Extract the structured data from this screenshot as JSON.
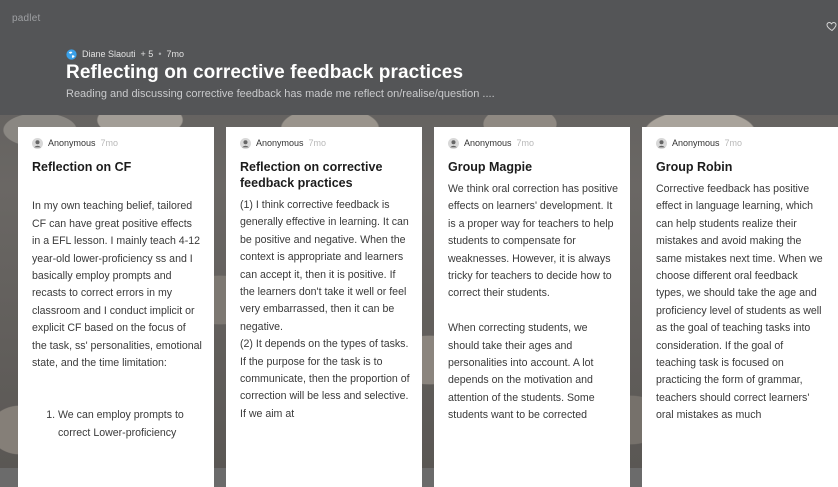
{
  "header": {
    "brand": "padlet",
    "author": "Diane Slaouti",
    "collaborators": "+ 5",
    "separator": "•",
    "time": "7mo",
    "title": "Reflecting on corrective feedback practices",
    "description": "Reading and discussing corrective feedback has made me reflect on/realise/question ....",
    "icons": {
      "favorite": "heart-icon",
      "author_avatar": "globe-icon"
    }
  },
  "posts": [
    {
      "author": "Anonymous",
      "time": "7mo",
      "title": "Reflection on CF",
      "body": "In my own teaching belief, tailored CF can have great positive effects in a EFL lesson. I mainly teach 4-12 year-old lower-proficiency ss and I basically employ prompts and recasts to correct errors in my classroom and I conduct implicit or explicit CF based on the focus of the task, ss' personalities, emotional state, and the time limitation:",
      "list": [
        "We can employ prompts to correct Lower-proficiency"
      ]
    },
    {
      "author": "Anonymous",
      "time": "7mo",
      "title": "Reflection on corrective feedback practices",
      "body": "(1) I think corrective feedback is generally effective in learning. It can be positive and negative. When the context is appropriate and learners can accept it, then it is positive. If the learners don't take it well or feel very embarrassed, then it can be negative.\n(2) It depends on the types of tasks. If the purpose for the task is to communicate, then the proportion of correction will be less and selective. If we aim at"
    },
    {
      "author": "Anonymous",
      "time": "7mo",
      "title": "Group Magpie",
      "body": "We think oral correction has positive effects on learners' development.  It is a proper way for teachers to help students to compensate for weaknesses. However, it is always tricky for teachers to decide how to correct their students.\n\nWhen correcting students, we should take their ages and personalities into account. A lot depends on the motivation and attention of the students. Some students want to be corrected"
    },
    {
      "author": "Anonymous",
      "time": "7mo",
      "title": "Group Robin",
      "body": "Corrective feedback has positive effect in language learning, which can help students realize their mistakes and avoid making the same mistakes next time. When we choose different oral feedback types, we should take the age and proficiency level of students as well as the goal of teaching tasks into consideration. If the goal of teaching task is focused on practicing the form of grammar, teachers should correct learners' oral mistakes as much"
    }
  ],
  "colors": {
    "header_bg": "#545557",
    "card_bg": "#ffffff",
    "title_text": "#ffffff"
  }
}
